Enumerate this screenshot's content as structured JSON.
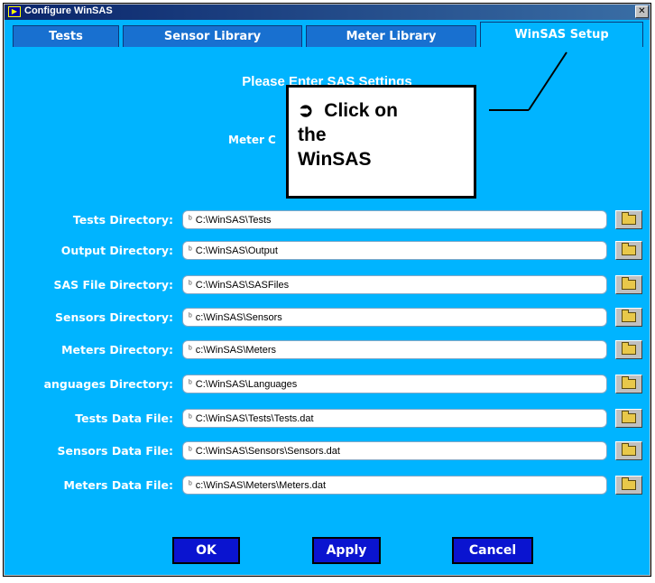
{
  "window": {
    "title": "Configure WinSAS",
    "close_glyph": "✕",
    "icon": "winsas-app-icon"
  },
  "tabs": [
    {
      "label": "Tests",
      "active": false
    },
    {
      "label": "Sensor Library",
      "active": false
    },
    {
      "label": "Meter Library",
      "active": false
    },
    {
      "label": "WinSAS Setup",
      "active": true
    }
  ],
  "heading": "Please Enter SAS Settings",
  "meter_label": "Meter C",
  "fields": [
    {
      "label": "Tests Directory:",
      "value": "C:\\WinSAS\\Tests"
    },
    {
      "label": "Output Directory:",
      "value": "C:\\WinSAS\\Output"
    },
    {
      "label": "SAS File Directory:",
      "value": "C:\\WinSAS\\SASFiles"
    },
    {
      "label": "Sensors Directory:",
      "value": "c:\\WinSAS\\Sensors"
    },
    {
      "label": "Meters Directory:",
      "value": "c:\\WinSAS\\Meters"
    },
    {
      "label": "anguages Directory:",
      "value": "C:\\WinSAS\\Languages"
    },
    {
      "label": "Tests Data File:",
      "value": "C:\\WinSAS\\Tests\\Tests.dat"
    },
    {
      "label": "Sensors Data File:",
      "value": "C:\\WinSAS\\Sensors\\Sensors.dat"
    },
    {
      "label": "Meters Data File:",
      "value": "c:\\WinSAS\\Meters\\Meters.dat"
    }
  ],
  "path_prefix_glyph": "ᵇ",
  "buttons": {
    "ok": "OK",
    "apply": "Apply",
    "cancel": "Cancel"
  },
  "callout": {
    "arrow": "➲",
    "text_line1": "Click on",
    "text_line2": "the",
    "text_line3": "WinSAS"
  },
  "colors": {
    "panel": "#00b4ff",
    "tab": "#1870d0",
    "button": "#0a14d0",
    "title_bar": "#0a246a"
  }
}
